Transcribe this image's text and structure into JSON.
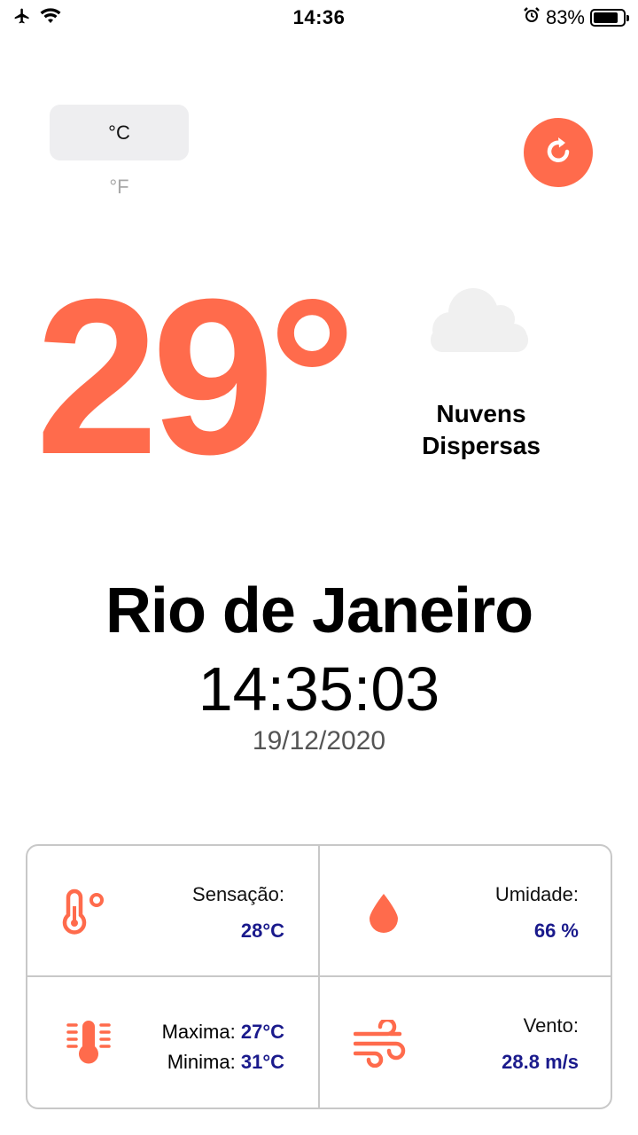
{
  "status_bar": {
    "time": "14:36",
    "battery_percent": "83%",
    "battery_level": 0.83,
    "icons": [
      "airplane-icon",
      "wifi-icon",
      "alarm-icon",
      "battery-icon"
    ]
  },
  "units": {
    "celsius_label": "°C",
    "fahrenheit_label": "°F",
    "selected": "°C"
  },
  "refresh": {
    "icon": "refresh-icon"
  },
  "current": {
    "temperature": "29°",
    "condition_line1": "Nuvens",
    "condition_line2": "Dispersas",
    "condition_icon": "cloud-icon"
  },
  "location": {
    "city": "Rio de Janeiro",
    "time": "14:35:03",
    "date": "19/12/2020"
  },
  "details": {
    "feels_like": {
      "label": "Sensação:",
      "value": "28°C",
      "icon": "thermometer-icon"
    },
    "humidity": {
      "label": "Umidade:",
      "value": "66 %",
      "icon": "water-drop-icon"
    },
    "max_min": {
      "max_label": "Maxima:",
      "max_value": "27°C",
      "min_label": "Minima:",
      "min_value": "31°C",
      "icon": "thermometer-range-icon"
    },
    "wind": {
      "label": "Vento:",
      "value": "28.8 m/s",
      "icon": "wind-icon"
    }
  },
  "colors": {
    "accent": "#ff6b4c",
    "value_text": "#1a1a8c",
    "toggle_bg": "#eeeef0",
    "cloud": "#f0f0f0"
  }
}
